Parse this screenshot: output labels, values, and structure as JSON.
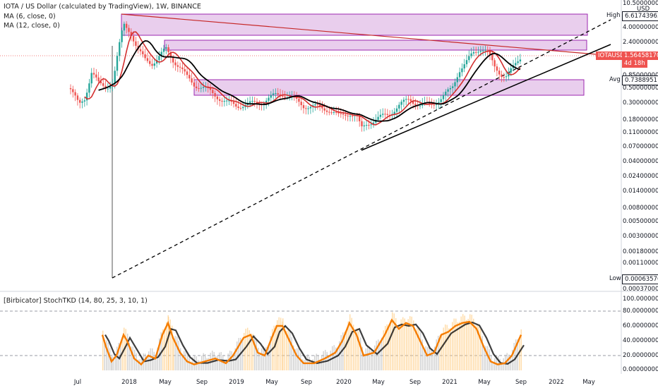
{
  "main_chart": {
    "title": "IOTA / US Dollar (calculated by TradingView), 1W, BINANCE",
    "ma1_label": "MA (6, close, 0)",
    "ma2_label": "MA (12, close, 0)",
    "price_axis_unit": "USD",
    "price_axis_labels": [
      "10.50000000",
      "4.00000000",
      "2.40000000",
      "1.40000000",
      "0.85000000",
      "0.50000000",
      "0.30000000",
      "0.18000000",
      "0.11000000",
      "0.07000000",
      "0.04000000",
      "0.02400000",
      "0.01400000",
      "0.00800000",
      "0.00500000",
      "0.00300000",
      "0.00180000",
      "0.00110000",
      "0.00037000"
    ],
    "high_label": "High",
    "high_value": "6.61743963",
    "avg_label": "Avg",
    "avg_value": "0.73889511",
    "low_label": "Low",
    "low_value": "0.00063576",
    "symbol_tag": "IOTAUSD",
    "current_price": "1.56458170",
    "countdown": "4d 18h",
    "colors": {
      "ma1": "#d32f2f",
      "ma2": "#000000",
      "zone_fill": "#e1bee7",
      "zone_border": "#9c27b0",
      "symbol_tag": "#ef5350",
      "up": "#26a69a",
      "down": "#ef5350"
    }
  },
  "oscillator": {
    "label": "[Birbicator] StochTKD (14, 80, 25, 3, 10, 1)",
    "axis_labels": [
      "100.00000000",
      "80.00000000",
      "60.00000000",
      "40.00000000",
      "20.00000000",
      "0.00000000"
    ],
    "colors": {
      "k_line": "#f57c00",
      "d_line": "#000000"
    }
  },
  "time_axis": [
    "Jul",
    "2018",
    "May",
    "Sep",
    "2019",
    "May",
    "Sep",
    "2020",
    "May",
    "Sep",
    "2021",
    "May",
    "Sep",
    "2022",
    "May"
  ]
}
